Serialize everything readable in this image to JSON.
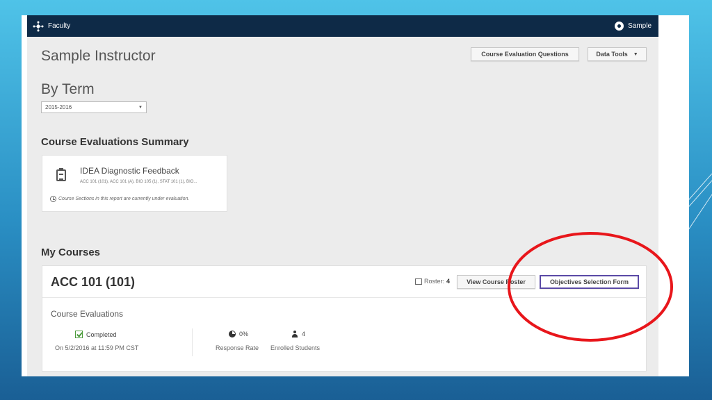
{
  "topbar": {
    "app_name": "Faculty",
    "user_name": "Sample"
  },
  "header": {
    "instructor_name": "Sample Instructor",
    "course_eval_questions_label": "Course Evaluation Questions",
    "data_tools_label": "Data Tools"
  },
  "term": {
    "heading": "By Term",
    "selected": "2015-2016"
  },
  "summary": {
    "heading": "Course Evaluations Summary",
    "card": {
      "name": "IDEA Diagnostic Feedback",
      "sections": "ACC 101 (101), ACC 101 (A), BIO 105 (1), STAT 101 (1), BIO...",
      "note": "Course Sections in this report are currently under evaluation."
    }
  },
  "courses": {
    "heading": "My Courses",
    "items": [
      {
        "name": "ACC 101 (101)",
        "roster_label": "Roster:",
        "roster_count": "4",
        "view_roster_label": "View Course Roster",
        "objectives_label": "Objectives Selection Form",
        "evaluations_label": "Course Evaluations",
        "status": "Completed",
        "deadline": "On 5/2/2016 at 11:59 PM CST",
        "response_rate_value": "0%",
        "response_rate_label": "Response Rate",
        "enrolled_value": "4",
        "enrolled_label": "Enrolled Students"
      }
    ]
  },
  "colors": {
    "topbar": "#0e2a47",
    "annotation_circle": "#e8161b",
    "objectives_border": "#5a4aa6",
    "completed_check": "#4a9a3a"
  },
  "icons": [
    "network-logo-icon",
    "user-avatar-icon",
    "chevron-down-icon",
    "clipboard-icon",
    "clock-icon",
    "roster-icon",
    "check-icon",
    "pie-chart-icon",
    "person-icon"
  ]
}
